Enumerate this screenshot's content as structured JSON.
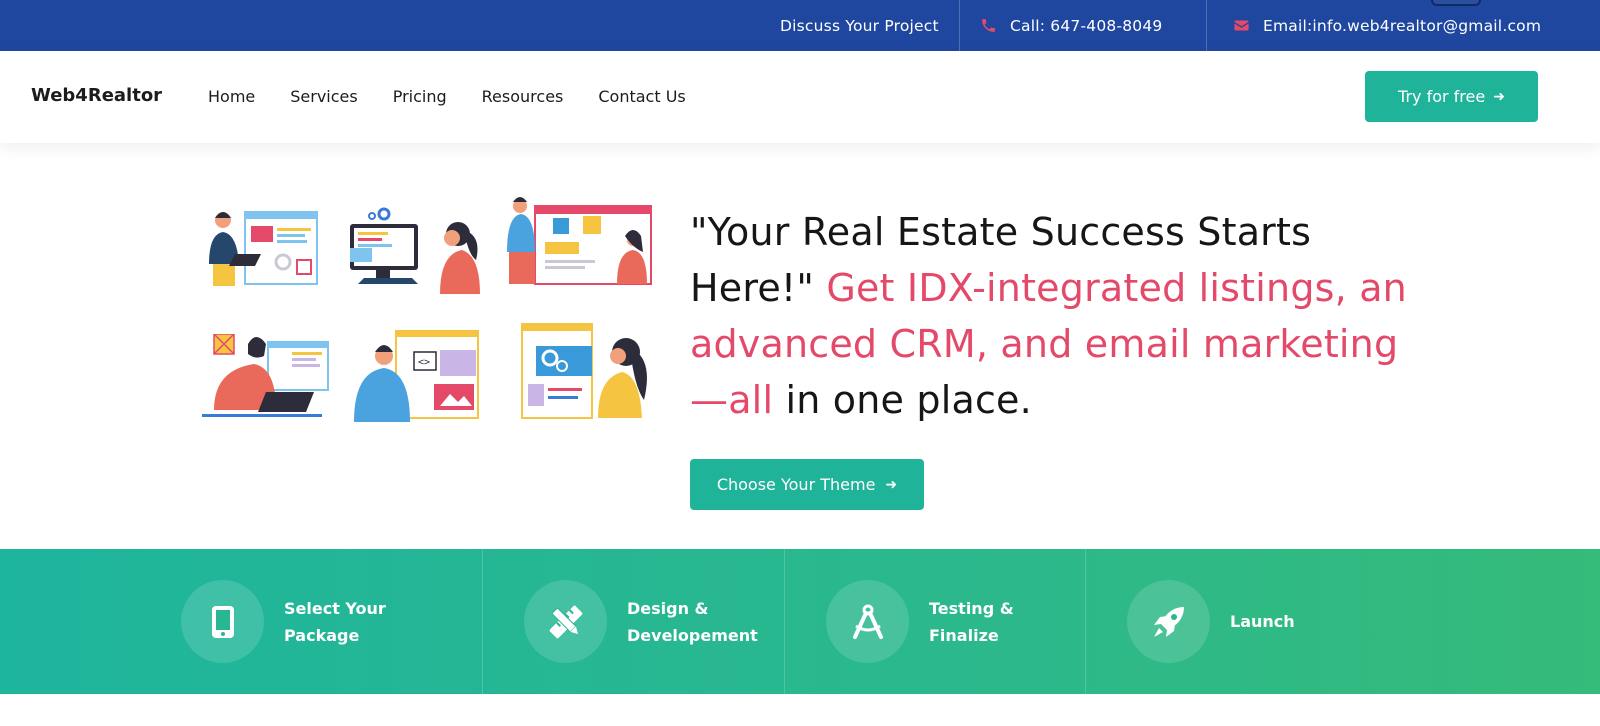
{
  "topbar": {
    "discuss": "Discuss Your Project",
    "call": "Call: 647-408-8049",
    "email": "Email:info.web4realtor@gmail.com"
  },
  "header": {
    "logo": "Web4Realtor",
    "nav": [
      "Home",
      "Services",
      "Pricing",
      "Resources",
      "Contact Us"
    ],
    "cta": "Try for free"
  },
  "hero": {
    "heading_part1": "\"Your Real Estate Success Starts Here!\" ",
    "heading_accent": "Get IDX-integrated listings, an advanced CRM, and email marketing—all",
    "heading_part2": " in one place.",
    "button": "Choose Your Theme"
  },
  "steps": [
    {
      "label_line1": "Select Your",
      "label_line2": "Package",
      "icon": "mobile-phone-icon"
    },
    {
      "label_line1": "Design &",
      "label_line2": "Developement",
      "icon": "pencil-ruler-icon"
    },
    {
      "label_line1": "Testing &",
      "label_line2": "Finalize",
      "icon": "drafting-compass-icon"
    },
    {
      "label_line1": "Launch",
      "label_line2": "",
      "icon": "rocket-icon"
    }
  ],
  "colors": {
    "topbar": "#1f47a0",
    "accent_green": "#1fb49a",
    "accent_pink": "#e4496a"
  }
}
